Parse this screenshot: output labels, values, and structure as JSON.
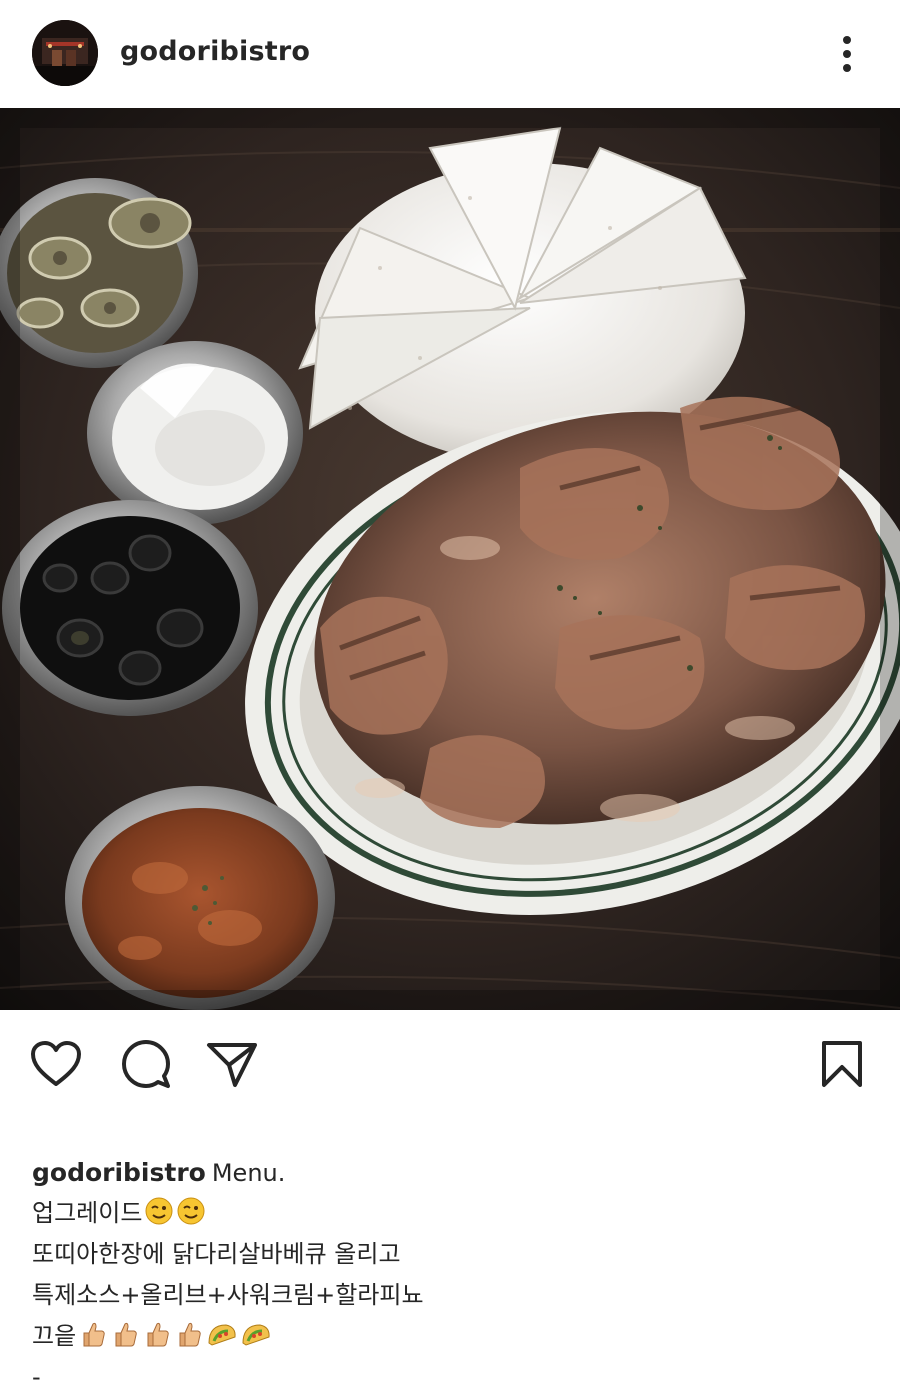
{
  "post": {
    "username": "godoribistro"
  },
  "caption": {
    "username": "godoribistro",
    "first_text": "Menu.",
    "line2": "업그레이드",
    "line3": "또띠아한장에 닭다리살바베큐 올리고",
    "line4": "특제소스+올리브+사워크림+할라피뇨",
    "line5": "끄읕",
    "line6": "-",
    "line2_emoji": [
      "winking-face",
      "winking-face"
    ],
    "line5_emoji": [
      "thumbs-up",
      "thumbs-up",
      "thumbs-up",
      "thumbs-up",
      "taco",
      "taco"
    ]
  },
  "icons": {
    "more": "more-vertical-icon",
    "like": "heart-outline-icon",
    "comment": "comment-bubble-icon",
    "share": "paper-plane-icon",
    "save": "bookmark-outline-icon"
  },
  "colors": {
    "text": "#262626",
    "background": "#ffffff"
  }
}
